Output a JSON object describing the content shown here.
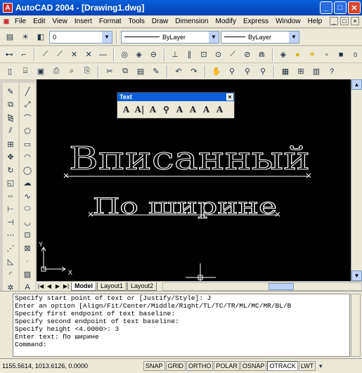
{
  "window": {
    "title": "AutoCAD 2004 - [Drawing1.dwg]",
    "app_icon": "A",
    "buttons": [
      "_",
      "□",
      "✕"
    ]
  },
  "menu": {
    "items": [
      "File",
      "Edit",
      "View",
      "Insert",
      "Format",
      "Tools",
      "Draw",
      "Dimension",
      "Modify",
      "Express",
      "Window",
      "Help"
    ],
    "doc_buttons": [
      "_",
      "□",
      "×"
    ]
  },
  "properties": {
    "layer_value": "0",
    "color_value": "ByLayer",
    "linetype_value": "ByLayer",
    "lineweight_value": "ByLayer"
  },
  "text_toolbar": {
    "title": "Text",
    "close": "✕",
    "icons": [
      "A",
      "A|",
      "A",
      "⚲",
      "A",
      "A",
      "A",
      "A"
    ]
  },
  "drawing": {
    "line1": "Вписанный",
    "line2": "По ширине",
    "ucs_x": "X",
    "ucs_y": "Y"
  },
  "tabs": {
    "nav": [
      "|◀",
      "◀",
      "▶",
      "▶|"
    ],
    "model": "Model",
    "layout1": "Layout1",
    "layout2": "Layout2"
  },
  "command_window": {
    "lines": [
      "Specify start point of text or [Justify/Style]: J",
      "Enter an option [Align/Fit/Center/Middle/Right/TL/TC/TR/ML/MC/MR/BL/B",
      "Specify first endpoint of text baseline:",
      "Specify second endpoint of text baseline:",
      "Specify height <4.0000>: 3",
      "Enter text: По ширине",
      "Command:"
    ]
  },
  "status": {
    "coords": "1155.5614, 1013.6126, 0.0000",
    "buttons": [
      "SNAP",
      "GRID",
      "ORTHO",
      "POLAR",
      "OSNAP",
      "OTRACK",
      "LWT"
    ],
    "active": [
      "OTRACK"
    ]
  },
  "colors": {
    "titlebar": "#0a5fd8",
    "drawing_bg": "#000000",
    "text_stroke": "#ffffff"
  }
}
